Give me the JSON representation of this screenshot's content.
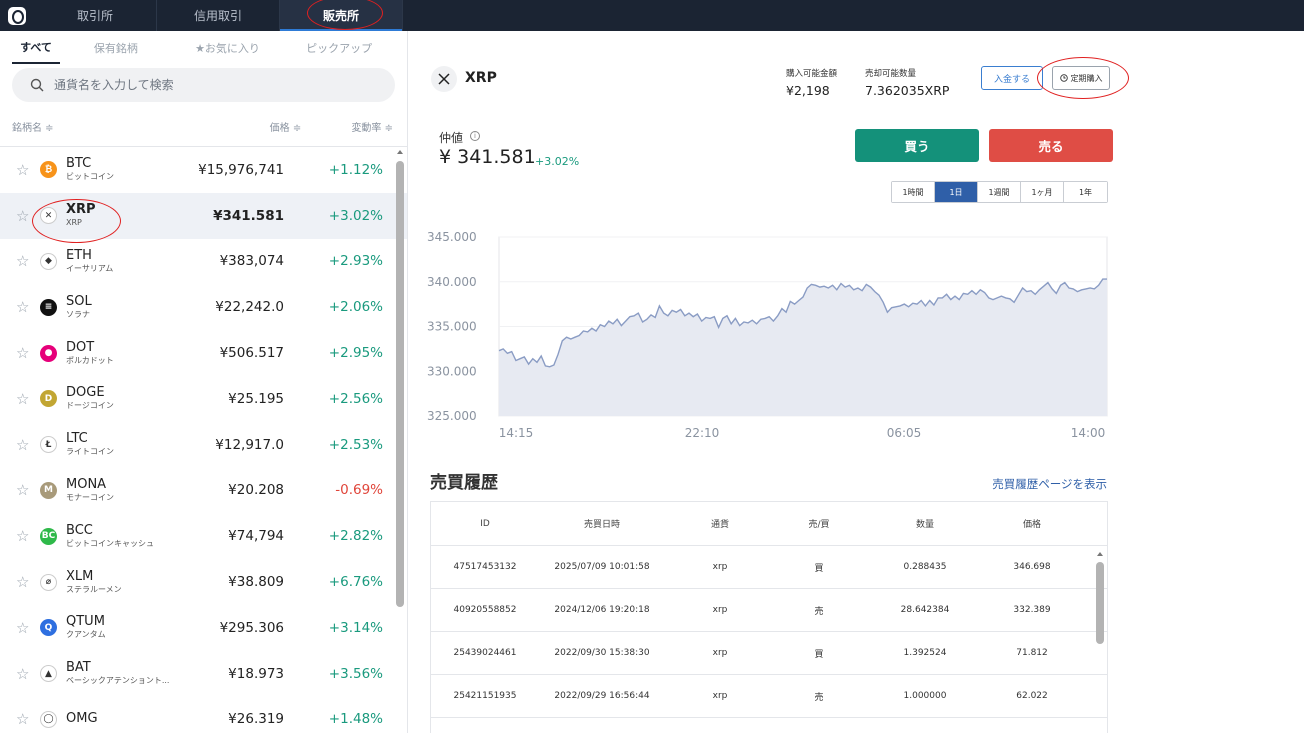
{
  "topbar": {
    "tabs": [
      {
        "label": "取引所"
      },
      {
        "label": "信用取引"
      },
      {
        "label": "販売所"
      }
    ]
  },
  "sidebar": {
    "subtabs": [
      {
        "label": "すべて"
      },
      {
        "label": "保有銘柄"
      },
      {
        "label": "★お気に入り"
      },
      {
        "label": "ピックアップ"
      }
    ],
    "search_placeholder": "通貨名を入力して検索",
    "columns": {
      "name": "銘柄名 ≑",
      "price": "価格 ≑",
      "change": "変動率 ≑"
    },
    "coins": [
      {
        "symbol": "BTC",
        "name": "ビットコイン",
        "price": "¥15,976,741",
        "change": "+1.12%",
        "icon_color": "#f7931a",
        "icon": "bitcoin-icon",
        "glyph": "₿"
      },
      {
        "symbol": "XRP",
        "name": "XRP",
        "price": "¥341.581",
        "change": "+3.02%",
        "icon_color": "#ffffff",
        "icon": "xrp-icon",
        "glyph": "✕"
      },
      {
        "symbol": "ETH",
        "name": "イーサリアム",
        "price": "¥383,074",
        "change": "+2.93%",
        "icon_color": "#ffffff",
        "icon": "ethereum-icon",
        "glyph": "◆"
      },
      {
        "symbol": "SOL",
        "name": "ソラナ",
        "price": "¥22,242.0",
        "change": "+2.06%",
        "icon_color": "#111111",
        "icon": "solana-icon",
        "glyph": "≡"
      },
      {
        "symbol": "DOT",
        "name": "ポルカドット",
        "price": "¥506.517",
        "change": "+2.95%",
        "icon_color": "#e6007a",
        "icon": "polkadot-icon",
        "glyph": "●"
      },
      {
        "symbol": "DOGE",
        "name": "ドージコイン",
        "price": "¥25.195",
        "change": "+2.56%",
        "icon_color": "#c2a633",
        "icon": "dogecoin-icon",
        "glyph": "D"
      },
      {
        "symbol": "LTC",
        "name": "ライトコイン",
        "price": "¥12,917.0",
        "change": "+2.53%",
        "icon_color": "#ffffff",
        "icon": "litecoin-icon",
        "glyph": "Ł"
      },
      {
        "symbol": "MONA",
        "name": "モナーコイン",
        "price": "¥20.208",
        "change": "-0.69%",
        "icon_color": "#a89a7a",
        "icon": "monacoin-icon",
        "glyph": "M"
      },
      {
        "symbol": "BCC",
        "name": "ビットコインキャッシュ",
        "price": "¥74,794",
        "change": "+2.82%",
        "icon_color": "#2fb94a",
        "icon": "bitcoincash-icon",
        "glyph": "BC"
      },
      {
        "symbol": "XLM",
        "name": "ステラルーメン",
        "price": "¥38.809",
        "change": "+6.76%",
        "icon_color": "#ffffff",
        "icon": "stellar-icon",
        "glyph": "⌀"
      },
      {
        "symbol": "QTUM",
        "name": "クアンタム",
        "price": "¥295.306",
        "change": "+3.14%",
        "icon_color": "#2e6fe0",
        "icon": "qtum-icon",
        "glyph": "Q"
      },
      {
        "symbol": "BAT",
        "name": "ベーシックアテンショント...",
        "price": "¥18.973",
        "change": "+3.56%",
        "icon_color": "#ffffff",
        "icon": "bat-icon",
        "glyph": "▲"
      },
      {
        "symbol": "OMG",
        "name": "",
        "price": "¥26.319",
        "change": "+1.48%",
        "icon_color": "#ffffff",
        "icon": "omg-icon",
        "glyph": "◯"
      }
    ]
  },
  "main": {
    "pair": "XRP",
    "buy_amount_label": "購入可能金額",
    "buy_amount_value": "¥2,198",
    "sell_qty_label": "売却可能数量",
    "sell_qty_value": "7.362035XRP",
    "deposit_label": "入金する",
    "recurring_label": "定期購入",
    "mid_label": "仲値",
    "mid_price": "¥ 341.581",
    "mid_change": "+3.02%",
    "buy_label": "買う",
    "sell_label": "売る",
    "periods": [
      "1時間",
      "1日",
      "1週間",
      "1ヶ月",
      "1年"
    ],
    "active_period": 1
  },
  "chart_data": {
    "type": "area",
    "y_ticks": [
      "345.000",
      "340.000",
      "335.000",
      "330.000",
      "325.000"
    ],
    "ylim": [
      325,
      345
    ],
    "x_ticks": [
      "14:15",
      "22:10",
      "06:05",
      "14:00"
    ],
    "line_color": "#8a9cc4",
    "fill_color": "#e7eaf2",
    "values": [
      332.3,
      332.5,
      332.0,
      332.2,
      331.2,
      331.4,
      331.6,
      330.8,
      331.4,
      331.0,
      331.7,
      330.6,
      330.5,
      330.7,
      331.9,
      333.4,
      333.8,
      333.6,
      333.8,
      334.0,
      334.5,
      334.4,
      334.8,
      334.5,
      335.2,
      335.0,
      335.6,
      335.3,
      335.8,
      335.1,
      335.6,
      336.1,
      336.2,
      336.5,
      335.5,
      335.8,
      336.3,
      336.0,
      337.3,
      336.5,
      336.2,
      336.8,
      336.6,
      336.9,
      336.2,
      336.5,
      336.1,
      336.4,
      335.6,
      336.0,
      335.9,
      336.1,
      334.9,
      335.9,
      336.2,
      335.3,
      335.9,
      335.1,
      335.5,
      335.4,
      335.7,
      335.3,
      335.8,
      335.9,
      336.1,
      335.6,
      336.2,
      337.0,
      336.6,
      337.8,
      337.5,
      337.9,
      338.3,
      339.3,
      339.7,
      339.6,
      339.4,
      339.5,
      339.3,
      339.6,
      339.1,
      339.8,
      339.4,
      339.6,
      339.1,
      339.3,
      339.0,
      339.7,
      339.4,
      338.9,
      338.5,
      337.7,
      336.6,
      337.1,
      337.2,
      337.3,
      337.5,
      337.2,
      337.6,
      337.5,
      337.9,
      337.3,
      337.9,
      337.4,
      338.2,
      338.2,
      338.6,
      338.0,
      338.4,
      338.0,
      338.7,
      338.6,
      339.0,
      338.6,
      339.1,
      338.8,
      338.2,
      338.0,
      338.2,
      338.4,
      338.2,
      338.1,
      337.7,
      338.5,
      339.3,
      338.9,
      339.0,
      338.6,
      339.1,
      339.5,
      339.9,
      339.2,
      338.7,
      339.6,
      339.9,
      339.3,
      339.2,
      338.9,
      339.1,
      339.2,
      339.3,
      339.2,
      339.6,
      340.3,
      340.3
    ]
  },
  "history": {
    "title": "売買履歴",
    "link": "売買履歴ページを表示",
    "headers": [
      "ID",
      "売買日時",
      "通貨",
      "売/買",
      "数量",
      "価格"
    ],
    "rows": [
      [
        "47517453132",
        "2025/07/09 10:01:58",
        "xrp",
        "買",
        "0.288435",
        "346.698"
      ],
      [
        "40920558852",
        "2024/12/06 19:20:18",
        "xrp",
        "売",
        "28.642384",
        "332.389"
      ],
      [
        "25439024461",
        "2022/09/30 15:38:30",
        "xrp",
        "買",
        "1.392524",
        "71.812"
      ],
      [
        "25421151935",
        "2022/09/29 16:56:44",
        "xrp",
        "売",
        "1.000000",
        "62.022"
      ]
    ]
  }
}
